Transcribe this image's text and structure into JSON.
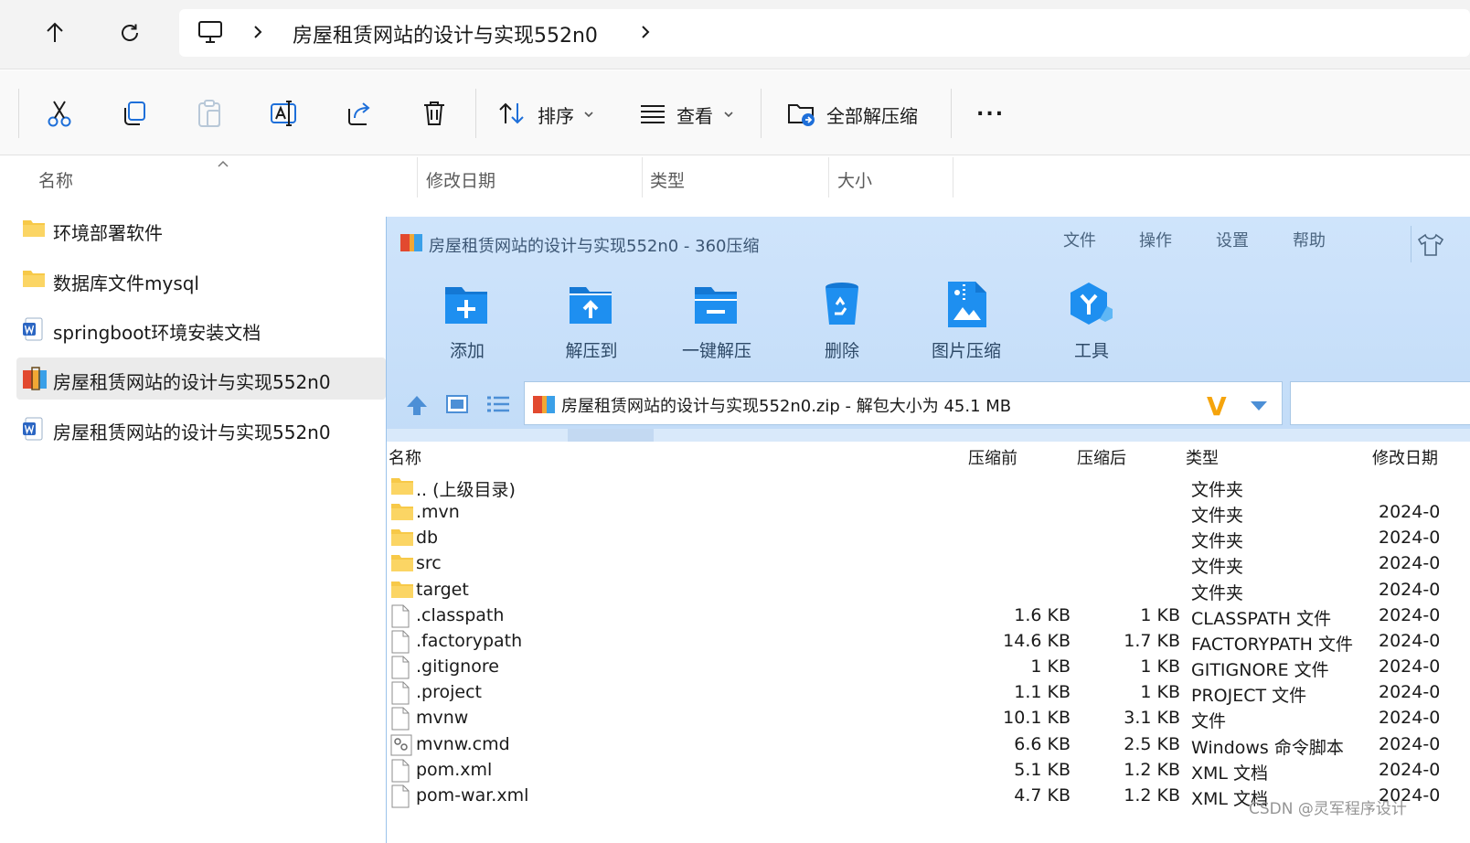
{
  "explorer": {
    "address": {
      "path_label": "房屋租赁网站的设计与实现552n0"
    },
    "toolbar": {
      "sort_label": "排序",
      "view_label": "查看",
      "extract_all_label": "全部解压缩",
      "more_label": "..."
    },
    "columns": {
      "name": "名称",
      "date": "修改日期",
      "type": "类型",
      "size": "大小"
    },
    "files": [
      {
        "name": "环境部署软件",
        "icon": "folder-icon"
      },
      {
        "name": "数据库文件mysql",
        "icon": "folder-icon"
      },
      {
        "name": "springboot环境安装文档",
        "icon": "word-doc-icon"
      },
      {
        "name": "房屋租赁网站的设计与实现552n0",
        "icon": "zip-archive-icon",
        "selected": true
      },
      {
        "name": "房屋租赁网站的设计与实现552n0",
        "icon": "word-doc-icon"
      }
    ]
  },
  "zip": {
    "title": "房屋租赁网站的设计与实现552n0 - 360压缩",
    "menu": [
      "文件",
      "操作",
      "设置",
      "帮助"
    ],
    "tools": [
      {
        "label": "添加",
        "icon": "add-folder-icon"
      },
      {
        "label": "解压到",
        "icon": "extract-to-icon"
      },
      {
        "label": "一键解压",
        "icon": "one-click-extract-icon"
      },
      {
        "label": "删除",
        "icon": "recycle-bin-icon"
      },
      {
        "label": "图片压缩",
        "icon": "image-compress-icon"
      },
      {
        "label": "工具",
        "icon": "tools-icon"
      }
    ],
    "path_text": "房屋租赁网站的设计与实现552n0.zip - 解包大小为 45.1 MB",
    "columns": {
      "name": "名称",
      "before": "压缩前",
      "after": "压缩后",
      "type": "类型",
      "date": "修改日期"
    },
    "rows": [
      {
        "name": ".. (上级目录)",
        "before": "",
        "after": "",
        "type": "文件夹",
        "date": "",
        "icon": "folder"
      },
      {
        "name": ".mvn",
        "before": "",
        "after": "",
        "type": "文件夹",
        "date": "2024-0",
        "icon": "folder"
      },
      {
        "name": "db",
        "before": "",
        "after": "",
        "type": "文件夹",
        "date": "2024-0",
        "icon": "folder"
      },
      {
        "name": "src",
        "before": "",
        "after": "",
        "type": "文件夹",
        "date": "2024-0",
        "icon": "folder"
      },
      {
        "name": "target",
        "before": "",
        "after": "",
        "type": "文件夹",
        "date": "2024-0",
        "icon": "folder"
      },
      {
        "name": ".classpath",
        "before": "1.6 KB",
        "after": "1 KB",
        "type": "CLASSPATH 文件",
        "date": "2024-0",
        "icon": "file"
      },
      {
        "name": ".factorypath",
        "before": "14.6 KB",
        "after": "1.7 KB",
        "type": "FACTORYPATH 文件",
        "date": "2024-0",
        "icon": "file"
      },
      {
        "name": ".gitignore",
        "before": "1 KB",
        "after": "1 KB",
        "type": "GITIGNORE 文件",
        "date": "2024-0",
        "icon": "file"
      },
      {
        "name": ".project",
        "before": "1.1 KB",
        "after": "1 KB",
        "type": "PROJECT 文件",
        "date": "2024-0",
        "icon": "file"
      },
      {
        "name": "mvnw",
        "before": "10.1 KB",
        "after": "3.1 KB",
        "type": "文件",
        "date": "2024-0",
        "icon": "file"
      },
      {
        "name": "mvnw.cmd",
        "before": "6.6 KB",
        "after": "2.5 KB",
        "type": "Windows 命令脚本",
        "date": "2024-0",
        "icon": "script"
      },
      {
        "name": "pom.xml",
        "before": "5.1 KB",
        "after": "1.2 KB",
        "type": "XML 文档",
        "date": "2024-0",
        "icon": "file"
      },
      {
        "name": "pom-war.xml",
        "before": "4.7 KB",
        "after": "1.2 KB",
        "type": "XML 文档",
        "date": "2024-0",
        "icon": "file"
      }
    ]
  },
  "watermark": "CSDN @灵军程序设计",
  "colors": {
    "zip_header_bg": "#c9e0f9",
    "folder_yellow": "#f7c948",
    "tool_blue": "#1e8ff0",
    "selection_gray": "#ebebeb"
  }
}
